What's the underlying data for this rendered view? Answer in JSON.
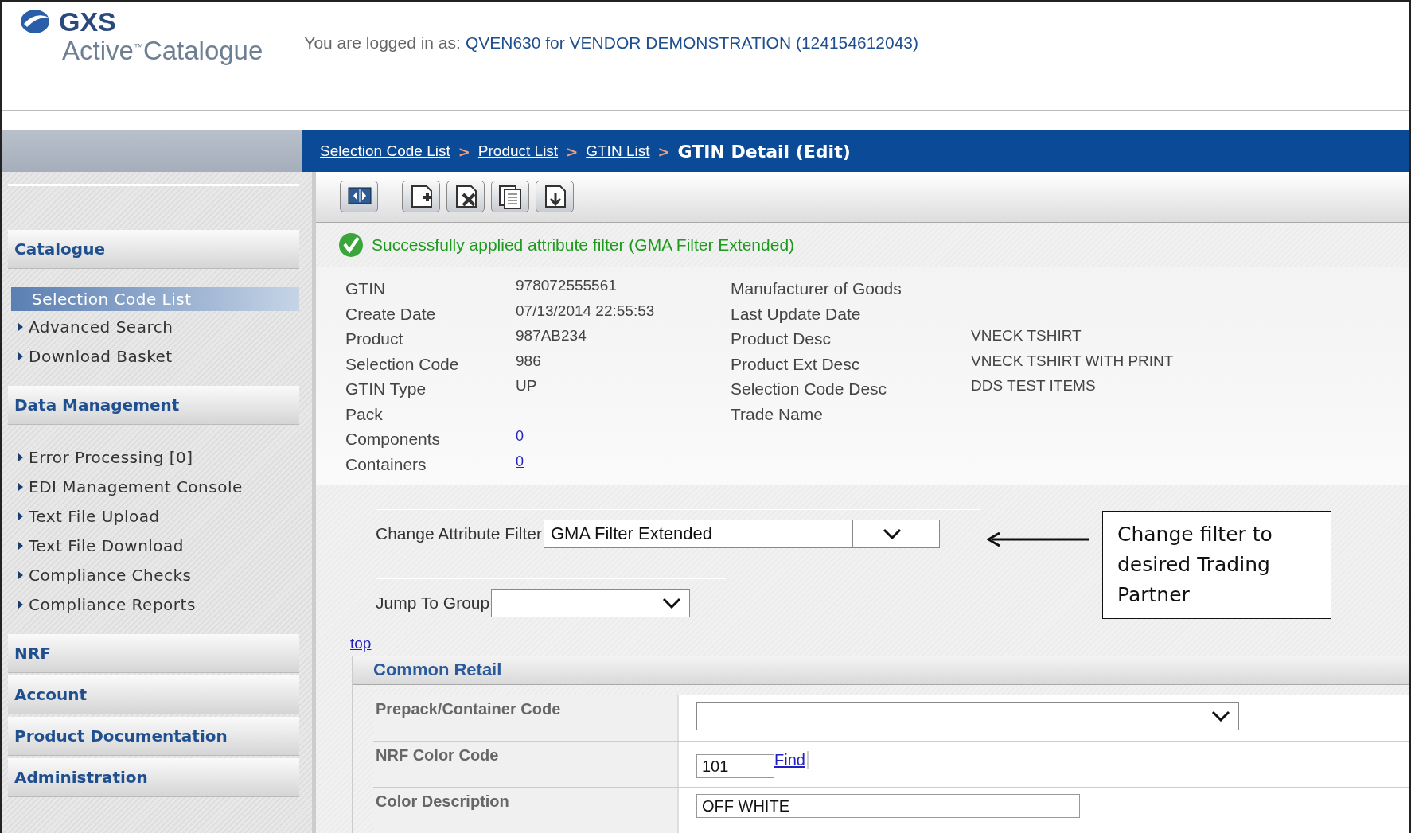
{
  "header": {
    "brand": "GXS",
    "product": "Active$^{™}$Catalogue",
    "login_label": "You are logged in as:",
    "login_user": "QVEN630 for VENDOR DEMONSTRATION (124154612043)"
  },
  "breadcrumb": {
    "links": [
      "Selection Code List",
      "Product List",
      "GTIN List"
    ],
    "separator": ">",
    "current": "GTIN Detail (Edit)"
  },
  "sidebar": {
    "sections": [
      {
        "title": "Catalogue",
        "items": [
          {
            "label": "Selection Code List",
            "selected": true
          },
          {
            "label": "Advanced Search",
            "selected": false
          },
          {
            "label": "Download Basket",
            "selected": false
          }
        ]
      },
      {
        "title": "Data Management",
        "items": [
          {
            "label": "Error Processing [0]",
            "selected": false
          },
          {
            "label": "EDI Management Console",
            "selected": false
          },
          {
            "label": "Text File Upload",
            "selected": false
          },
          {
            "label": "Text File Download",
            "selected": false
          },
          {
            "label": "Compliance Checks",
            "selected": false
          },
          {
            "label": "Compliance Reports",
            "selected": false
          }
        ]
      },
      {
        "title": "NRF"
      },
      {
        "title": "Account"
      },
      {
        "title": "Product Documentation"
      },
      {
        "title": "Administration"
      }
    ]
  },
  "toolbar": [
    {
      "kind": "panel"
    },
    {
      "kind": "add"
    },
    {
      "kind": "delete"
    },
    {
      "kind": "copy"
    },
    {
      "kind": "download"
    }
  ],
  "message": {
    "kind": "success",
    "text": "Successfully applied attribute filter (GMA Filter Extended)"
  },
  "details": {
    "left": [
      {
        "label": "GTIN",
        "value": "978072555561",
        "kind": "text"
      },
      {
        "label": "Create Date",
        "value": "07/13/2014 22:55:53",
        "kind": "text"
      },
      {
        "label": "Product",
        "value": "987AB234",
        "kind": "text"
      },
      {
        "label": "Selection Code",
        "value": "986",
        "kind": "text"
      },
      {
        "label": "GTIN Type",
        "value": "UP",
        "kind": "text"
      },
      {
        "label": "Pack"
      },
      {
        "label": "Components",
        "value": "0",
        "kind": "link"
      },
      {
        "label": "Containers",
        "value": "0",
        "kind": "link"
      }
    ],
    "right": [
      {
        "label": "Manufacturer of Goods"
      },
      {
        "label": "Last Update Date"
      },
      {
        "label": "Product Desc",
        "value": "VNECK TSHIRT"
      },
      {
        "label": "Product Ext Desc",
        "value": "VNECK TSHIRT WITH PRINT"
      },
      {
        "label": "Selection Code Desc",
        "value": "DDS TEST ITEMS"
      },
      {
        "label": "Trade Name"
      }
    ]
  },
  "attribute_filter": {
    "label": "Change Attribute Filter",
    "value": "GMA Filter Extended"
  },
  "jump_to_group": {
    "label": "Jump To Group"
  },
  "top_link": "top",
  "section": {
    "title": "Common Retail",
    "rows": [
      {
        "label": "Prepack/Container Code",
        "kind": "select"
      },
      {
        "label": "NRF Color Code",
        "kind": "lookup",
        "value": "101",
        "link": "Find"
      },
      {
        "label": "Color Description",
        "kind": "text",
        "value": "OFF WHITE"
      }
    ]
  },
  "annotation": {
    "text": "Change filter to desired Trading Partner"
  }
}
